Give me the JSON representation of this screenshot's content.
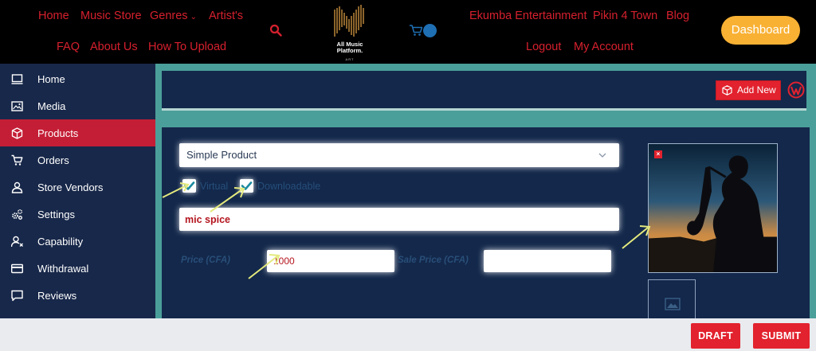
{
  "nav": {
    "home": "Home",
    "music_store": "Music Store",
    "genres": "Genres",
    "artists": "Artist's",
    "faq": "FAQ",
    "about": "About Us",
    "how_to_upload": "How To Upload",
    "ekumba": "Ekumba Entertainment",
    "pikin": "Pikin 4 Town",
    "blog": "Blog",
    "logout": "Logout",
    "my_account": "My Account",
    "dashboard": "Dashboard",
    "logo_line1": "All Music",
    "logo_line2": "Platform.",
    "logo_sub": "ART"
  },
  "sidebar": {
    "items": [
      {
        "label": "Home",
        "icon": "monitor-icon"
      },
      {
        "label": "Media",
        "icon": "image-icon"
      },
      {
        "label": "Products",
        "icon": "cube-icon",
        "active": true
      },
      {
        "label": "Orders",
        "icon": "cart-icon"
      },
      {
        "label": "Store Vendors",
        "icon": "user-icon"
      },
      {
        "label": "Settings",
        "icon": "gears-icon"
      },
      {
        "label": "Capability",
        "icon": "user-x-icon"
      },
      {
        "label": "Withdrawal",
        "icon": "credit-card-icon"
      },
      {
        "label": "Reviews",
        "icon": "comment-icon"
      }
    ]
  },
  "toolbar": {
    "add_new": "Add New"
  },
  "form": {
    "product_type": "Simple Product",
    "virtual_label": "Virtual",
    "virtual_checked": true,
    "downloadable_label": "Downloadable",
    "downloadable_checked": true,
    "product_name": "mic spice",
    "price_label": "Price (CFA)",
    "price_value": "1000",
    "sale_price_label": "Sale Price (CFA)",
    "sale_price_value": ""
  },
  "actions": {
    "draft": "DRAFT",
    "submit": "SUBMIT"
  },
  "colors": {
    "accent_red": "#e2222e",
    "nav_red": "#d6202e",
    "dashboard_yellow": "#f9b134",
    "sidebar_bg": "#18284a",
    "panel_bg": "#13284b",
    "teal_bg": "#4b9f9a",
    "arrow_yellow": "#e4ea7d"
  }
}
